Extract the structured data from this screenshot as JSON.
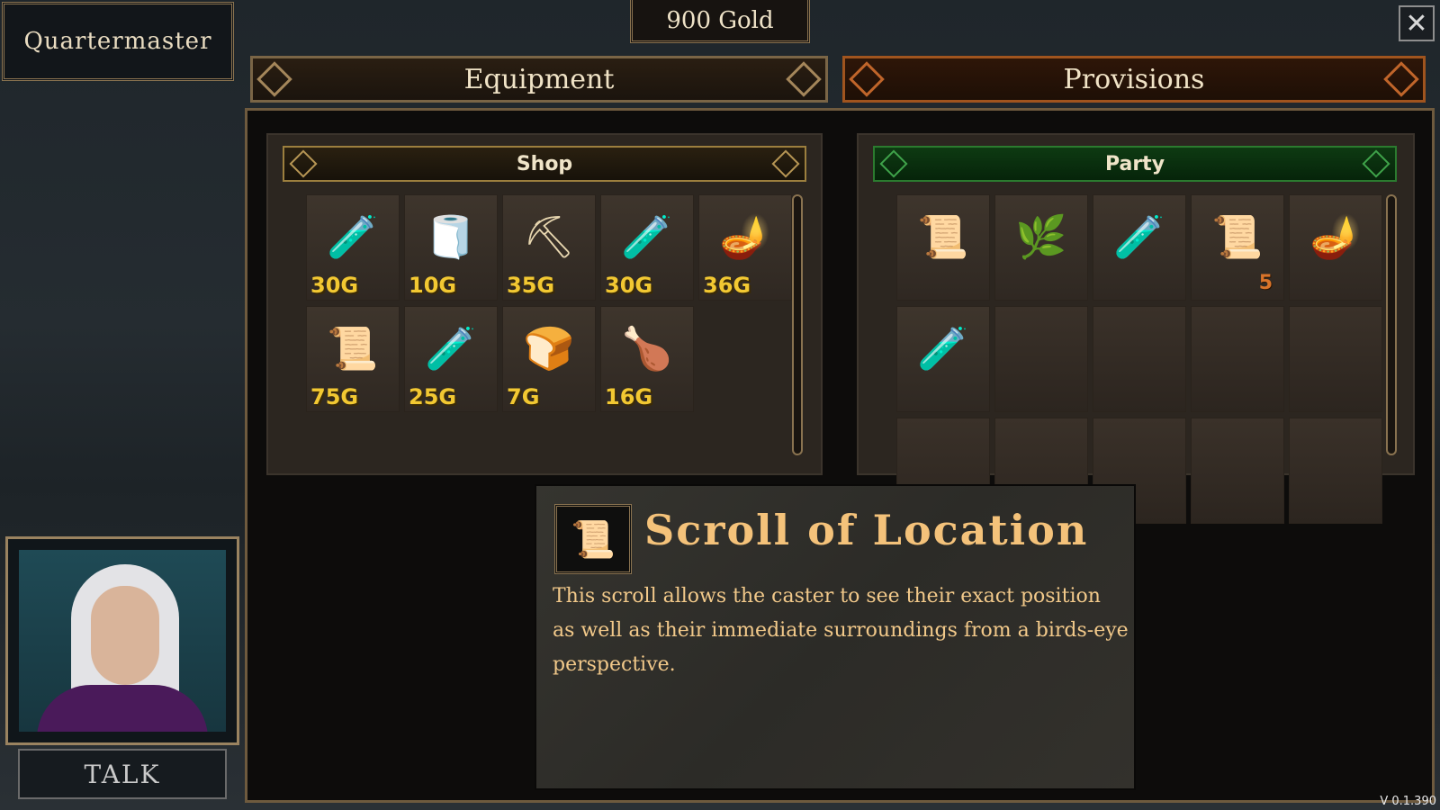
{
  "merchant": {
    "title": "Quartermaster"
  },
  "gold": {
    "label": "900 Gold"
  },
  "tabs": [
    {
      "label": "Equipment",
      "active": false
    },
    {
      "label": "Provisions",
      "active": true
    }
  ],
  "shop": {
    "header": "Shop",
    "items": [
      {
        "icon": "green-potion-icon",
        "glyph": "🧪",
        "price": "30G"
      },
      {
        "icon": "bandage-roll-icon",
        "glyph": "🧻",
        "price": "10G"
      },
      {
        "icon": "pickaxe-icon",
        "glyph": "⛏",
        "price": "35G"
      },
      {
        "icon": "red-potion-icon",
        "glyph": "🧪",
        "price": "30G"
      },
      {
        "icon": "oil-lamp-icon",
        "glyph": "🪔",
        "price": "36G"
      },
      {
        "icon": "scroll-icon",
        "glyph": "📜",
        "price": "75G"
      },
      {
        "icon": "purple-potion-icon",
        "glyph": "🧪",
        "price": "25G"
      },
      {
        "icon": "bread-icon",
        "glyph": "🍞",
        "price": "7G"
      },
      {
        "icon": "meat-leg-icon",
        "glyph": "🍗",
        "price": "16G"
      }
    ]
  },
  "party": {
    "header": "Party",
    "items": [
      {
        "icon": "map-scroll-icon",
        "glyph": "📜",
        "qty": ""
      },
      {
        "icon": "herb-pouch-icon",
        "glyph": "🌿",
        "qty": ""
      },
      {
        "icon": "purple-potion-icon",
        "glyph": "🧪",
        "qty": ""
      },
      {
        "icon": "scroll-icon",
        "glyph": "📜",
        "qty": "5"
      },
      {
        "icon": "oil-lamp-icon",
        "glyph": "🪔",
        "qty": ""
      },
      {
        "icon": "red-potion-icon",
        "glyph": "🧪",
        "qty": ""
      }
    ],
    "empty_slots": 9
  },
  "description": {
    "icon": "scroll-icon",
    "glyph": "📜",
    "title": "Scroll of Location",
    "text": "This scroll allows the caster to see their exact position as well as their immediate surroundings from a birds-eye perspective."
  },
  "talk": {
    "label": "TALK"
  },
  "version": "V 0.1.390",
  "close": {
    "glyph": "✕"
  },
  "colors": {
    "price": "#f2c832",
    "active_tab": "#a0541e",
    "party_header": "#06240a",
    "desc_title": "#f4c27a"
  }
}
